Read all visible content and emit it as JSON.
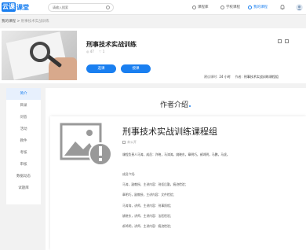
{
  "brand": {
    "badge": "云课",
    "name": "课堂"
  },
  "search": {
    "placeholder": "请输入搜索"
  },
  "nav": [
    {
      "label": "课程库"
    },
    {
      "label": "学校课程"
    },
    {
      "label": "我的课程"
    }
  ],
  "breadcrumb": {
    "parent": "我的课程",
    "separator": ">",
    "current": "刑事技术实战训练"
  },
  "course": {
    "title": "刑事技术实战训练",
    "views": "◎ 47",
    "likes": "♡ 1",
    "btn_primary": "选课",
    "btn_secondary": "授课",
    "hours_label": "建议课时:",
    "hours_value": "24 小时",
    "author_label": "作者:",
    "author_value": "刑事技术实战训练课程组"
  },
  "sidebar": {
    "items": [
      "简介",
      "目录",
      "问答",
      "活动",
      "教件",
      "考核",
      "审核",
      "数据动态",
      "试题库"
    ]
  },
  "section": {
    "title": "作者介绍"
  },
  "author_card": {
    "name": "刑事技术实战训练课程组",
    "location": "未公开",
    "intro": "课程负责人马涛，成员：许晓，马涛涛，姚晓东，章明巧，郝鸿明，马鹏，马虎。",
    "members_title": "成员介绍:",
    "members": [
      "马涛，副教授，主讲内容：刑侦后勤，痕迹检验；",
      "章明巧，副教授，主讲内容：文件检验；",
      "马涛涛，讲师，主讲内容：刑事照相；",
      "姚晓东，讲师，主讲内容：法医检验；",
      "郝鸿明，讲师，主讲内容：痕迹检验；"
    ]
  },
  "colors": {
    "accent": "#1a7ff0"
  }
}
